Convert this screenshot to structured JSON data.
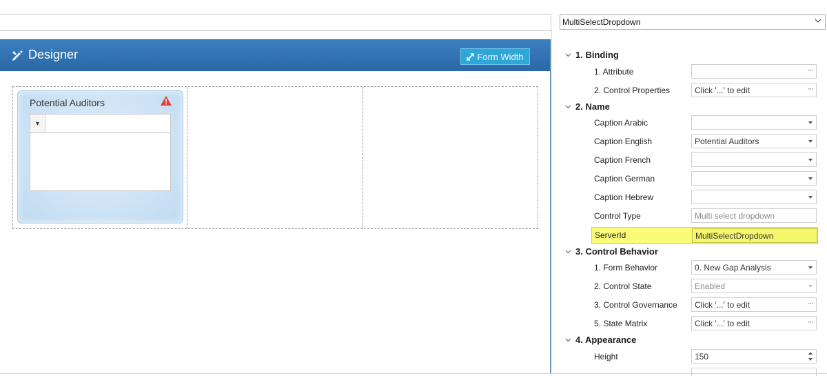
{
  "designer": {
    "title": "Designer",
    "form_width_label": "Form Width",
    "control": {
      "caption": "Potential Auditors",
      "warning_icon": "warning-triangle-icon",
      "type": "multi-select-dropdown"
    }
  },
  "properties": {
    "object_selector": "MultiSelectDropdown",
    "sections": [
      {
        "label": "1. Binding",
        "rows": [
          {
            "label": "1. Attribute",
            "value": "",
            "editor": "ellipsis"
          },
          {
            "label": "2. Control Properties",
            "value": "Click '...' to edit",
            "editor": "ellipsis"
          }
        ]
      },
      {
        "label": "2. Name",
        "rows": [
          {
            "label": "Caption Arabic",
            "value": "",
            "editor": "dropdown"
          },
          {
            "label": "Caption English",
            "value": "Potential Auditors",
            "editor": "dropdown"
          },
          {
            "label": "Caption French",
            "value": "",
            "editor": "dropdown"
          },
          {
            "label": "Caption German",
            "value": "",
            "editor": "dropdown"
          },
          {
            "label": "Caption Hebrew",
            "value": "",
            "editor": "dropdown"
          },
          {
            "label": "Control Type",
            "value": "Multi select dropdown",
            "editor": "readonly"
          },
          {
            "label": "ServerId",
            "value": "MultiSelectDropdown",
            "editor": "text",
            "highlighted": true
          }
        ]
      },
      {
        "label": "3. Control Behavior",
        "rows": [
          {
            "label": "1. Form Behavior",
            "value": "0. New Gap Analysis",
            "editor": "dropdown"
          },
          {
            "label": "2. Control State",
            "value": "Enabled",
            "editor": "dropdown-disabled"
          },
          {
            "label": "3. Control Governance",
            "value": "Click '...' to edit",
            "editor": "ellipsis"
          },
          {
            "label": "5. State Matrix",
            "value": "Click '...' to edit",
            "editor": "ellipsis"
          }
        ]
      },
      {
        "label": "4. Appearance",
        "rows": [
          {
            "label": "Height",
            "value": "150",
            "editor": "spinner"
          }
        ]
      }
    ]
  },
  "colors": {
    "header_blue": "#2e72b3",
    "button_blue": "#2fa6d8",
    "highlight_yellow": "#fbfb78"
  }
}
